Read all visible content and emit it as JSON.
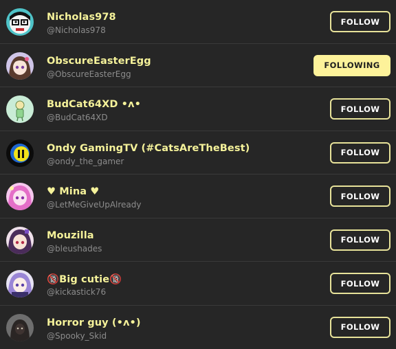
{
  "users": [
    {
      "name": "Nicholas978",
      "handle": "@Nicholas978",
      "button": "FOLLOW",
      "following": false,
      "avatar_icon": "cartoon-face-with-glasses-avatar"
    },
    {
      "name": "ObscureEasterEgg",
      "handle": "@ObscureEasterEgg",
      "button": "FOLLOWING",
      "following": true,
      "avatar_icon": "anime-girl-brown-hair-avatar"
    },
    {
      "name": "BudCat64XD •ʌ•",
      "handle": "@BudCat64XD",
      "button": "FOLLOW",
      "following": false,
      "avatar_icon": "green-character-sketch-avatar"
    },
    {
      "name": "Ondy GamingTV (#CatsAreTheBest)",
      "handle": "@ondy_the_gamer",
      "button": "FOLLOW",
      "following": false,
      "avatar_icon": "yellow-pause-icon-avatar"
    },
    {
      "name": "♥ Mina ♥",
      "handle": "@LetMeGiveUpAlready",
      "button": "FOLLOW",
      "following": false,
      "avatar_icon": "pink-hair-anime-avatar"
    },
    {
      "name": "Mouzilla",
      "handle": "@bleushades",
      "button": "FOLLOW",
      "following": false,
      "avatar_icon": "purple-hair-anime-avatar"
    },
    {
      "name": "🔞Big cutie🔞",
      "handle": "@kickastick76",
      "button": "FOLLOW",
      "following": false,
      "avatar_icon": "lavender-hair-anime-avatar"
    },
    {
      "name": "Horror guy (•ʌ•)",
      "handle": "@Spooky_Skid",
      "button": "FOLLOW",
      "following": false,
      "avatar_icon": "dark-hooded-figure-avatar"
    }
  ],
  "colors": {
    "background": "#262626",
    "name": "#f5f29a",
    "handle": "#8c8c8c",
    "accent": "#fdf29a",
    "divider": "#3a3a3a"
  }
}
